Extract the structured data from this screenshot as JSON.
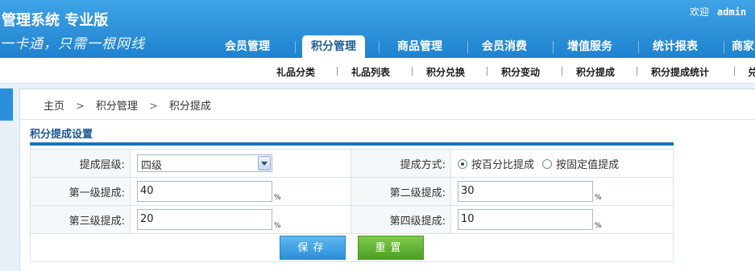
{
  "header": {
    "system_title": "管理系统 专业版",
    "slogan": "一卡通，只需一根网线",
    "welcome_text": "欢迎",
    "username": "admin"
  },
  "main_nav": {
    "tabs": [
      {
        "label": "会员管理",
        "active": false
      },
      {
        "label": "积分管理",
        "active": true
      },
      {
        "label": "商品管理",
        "active": false
      },
      {
        "label": "会员消费",
        "active": false
      },
      {
        "label": "增值服务",
        "active": false
      },
      {
        "label": "统计报表",
        "active": false
      },
      {
        "label": "商家",
        "active": false
      }
    ]
  },
  "sub_nav": {
    "items": [
      "礼品分类",
      "礼品列表",
      "积分兑换",
      "积分变动",
      "积分提成",
      "积分提成统计",
      "兑"
    ]
  },
  "breadcrumb": {
    "home": "主页",
    "level1": "积分管理",
    "level2": "积分提成",
    "separator": ">"
  },
  "section": {
    "title": "积分提成设置"
  },
  "form": {
    "level_label": "提成层级:",
    "level_value": "四级",
    "mode_label": "提成方式:",
    "mode_options": [
      {
        "label": "按百分比提成",
        "checked": true
      },
      {
        "label": "按固定值提成",
        "checked": false
      }
    ],
    "level1_label": "第一级提成:",
    "level1_value": "40",
    "level2_label": "第二级提成:",
    "level2_value": "30",
    "level3_label": "第三级提成:",
    "level3_value": "20",
    "level4_label": "第四级提成:",
    "level4_value": "10",
    "unit": "%"
  },
  "buttons": {
    "save": "保存",
    "reset": "重置"
  },
  "colors": {
    "header_blue": "#2c8fd8",
    "section_title": "#1a5790",
    "save_button": "#2b8ed8",
    "reset_button": "#4a9f25"
  }
}
